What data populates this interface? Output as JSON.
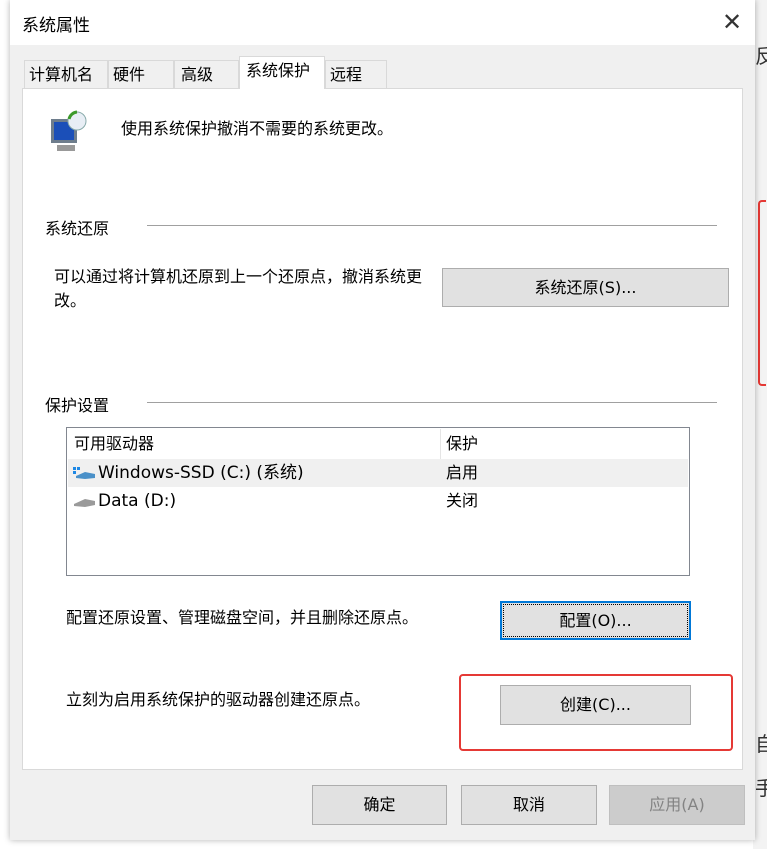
{
  "background_fragments": [
    "反",
    "自",
    "手"
  ],
  "dialog": {
    "title": "系统属性",
    "tabs": [
      "计算机名",
      "硬件",
      "高级",
      "系统保护",
      "远程"
    ],
    "active_tab": "系统保护",
    "intro": "使用系统保护撤消不需要的系统更改。",
    "restore": {
      "header": "系统还原",
      "description": "可以通过将计算机还原到上一个还原点，撤消系统更改。",
      "button": "系统还原(S)..."
    },
    "protection": {
      "header": "保护设置",
      "columns": [
        "可用驱动器",
        "保护"
      ],
      "drives": [
        {
          "name": "Windows-SSD (C:) (系统)",
          "status": "启用",
          "icon": "system-drive-icon"
        },
        {
          "name": "Data (D:)",
          "status": "关闭",
          "icon": "drive-icon"
        }
      ],
      "configure_text": "配置还原设置、管理磁盘空间，并且删除还原点。",
      "configure_button": "配置(O)...",
      "create_text": "立刻为启用系统保护的驱动器创建还原点。",
      "create_button": "创建(C)..."
    },
    "buttons": {
      "ok": "确定",
      "cancel": "取消",
      "apply": "应用(A)"
    },
    "highlight_color": "#e53935"
  }
}
